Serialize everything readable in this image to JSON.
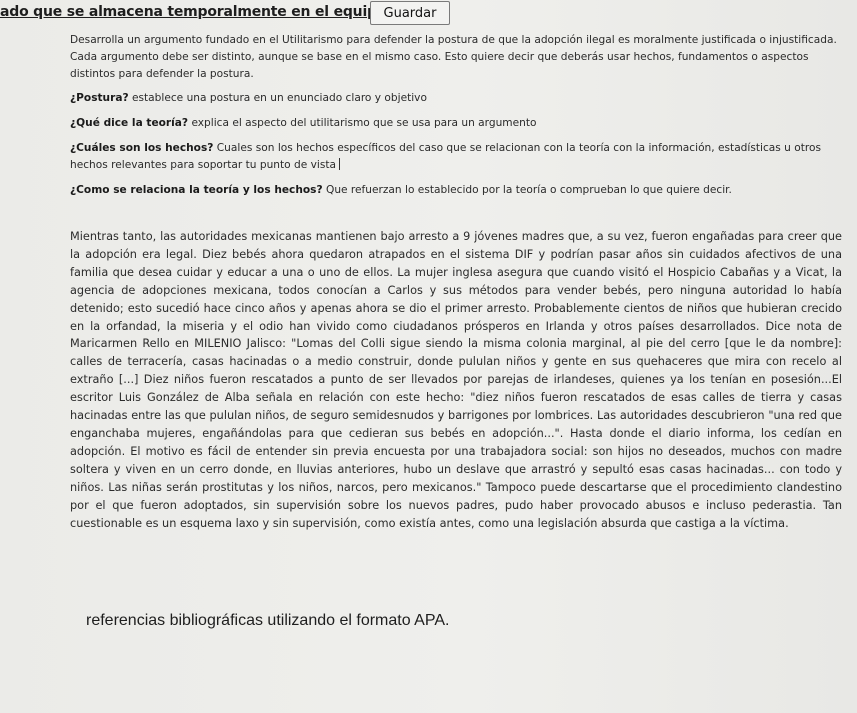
{
  "topbar": {
    "truncated_text": "ado que se almacena temporalmente en el equipo.",
    "save_label": "Guardar"
  },
  "instructions": {
    "intro": "Desarrolla un argumento fundado en el Utilitarismo para defender la postura de que la adopción ilegal es moralmente justificada o injustificada. Cada argumento debe ser distinto, aunque se base en el mismo caso. Esto quiere decir que deberás usar hechos, fundamentos o aspectos distintos para defender la postura.",
    "questions": [
      {
        "label": "¿Postura?",
        "text": " establece una postura en un enunciado claro y objetivo"
      },
      {
        "label": "¿Qué dice la teoría?",
        "text": " explica el aspecto del utilitarismo que se usa para un argumento"
      },
      {
        "label": "¿Cuáles son los hechos?",
        "text": " Cuales son los hechos específicos del caso que se relacionan con la teoría con la información, estadísticas u otros hechos relevantes para soportar tu punto de vista"
      },
      {
        "label": "¿Como se relaciona la teoría y los hechos?",
        "text": " Que refuerzan lo establecido por la teoría o comprueban lo que quiere decir."
      }
    ]
  },
  "essay": {
    "text": "Mientras tanto, las autoridades mexicanas mantienen bajo arresto a 9 jóvenes madres que, a su vez, fueron engañadas para creer que la adopción era legal. Diez bebés ahora quedaron atrapados en el sistema DIF y podrían pasar años sin cuidados afectivos de una familia que desea cuidar y educar a una o uno de ellos. La mujer inglesa asegura que cuando visitó el Hospicio Cabañas y a Vicat, la agencia de adopciones mexicana, todos conocían a Carlos y sus métodos para vender bebés, pero ninguna autoridad lo había detenido; esto sucedió hace cinco años y apenas ahora se dio el primer arresto. Probablemente cientos de niños que hubieran crecido en la orfandad, la miseria y el odio han vivido como ciudadanos prósperos en Irlanda y otros países desarrollados. Dice nota de Maricarmen Rello en MILENIO Jalisco: \"Lomas del Colli sigue siendo la misma colonia marginal, al pie del cerro [que le da nombre]: calles de terracería, casas hacinadas o a medio construir, donde pululan niños y gente en sus quehaceres que mira con recelo al extraño [...] Diez niños fueron rescatados a punto de ser llevados por parejas de irlandeses, quienes ya los tenían en posesión...El escritor Luis González de Alba señala en relación con este hecho: \"diez niños fueron rescatados de esas calles de tierra y casas hacinadas entre las que pululan niños, de seguro semidesnudos y barrigones por lombrices. Las autoridades descubrieron \"una red que enganchaba mujeres, engañándolas para que cedieran sus bebés en adopción...\". Hasta donde el diario informa, los cedían en adopción. El motivo es fácil de entender sin previa encuesta por una trabajadora social: son hijos no deseados, muchos con madre soltera y viven en un cerro donde, en lluvias anteriores, hubo un deslave que arrastró y sepultó esas casas hacinadas... con todo y niños. Las niñas serán prostitutas y los niños, narcos, pero mexicanos.\" Tampoco puede descartarse que el procedimiento clandestino por el que fueron adoptados, sin supervisión sobre los nuevos padres, pudo haber provocado abusos e incluso pederastia. Tan cuestionable es un esquema laxo y sin supervisión, como existía antes, como una legislación absurda que castiga a la víctima."
  },
  "references": {
    "heading": "referencias bibliográficas utilizando el formato APA."
  }
}
